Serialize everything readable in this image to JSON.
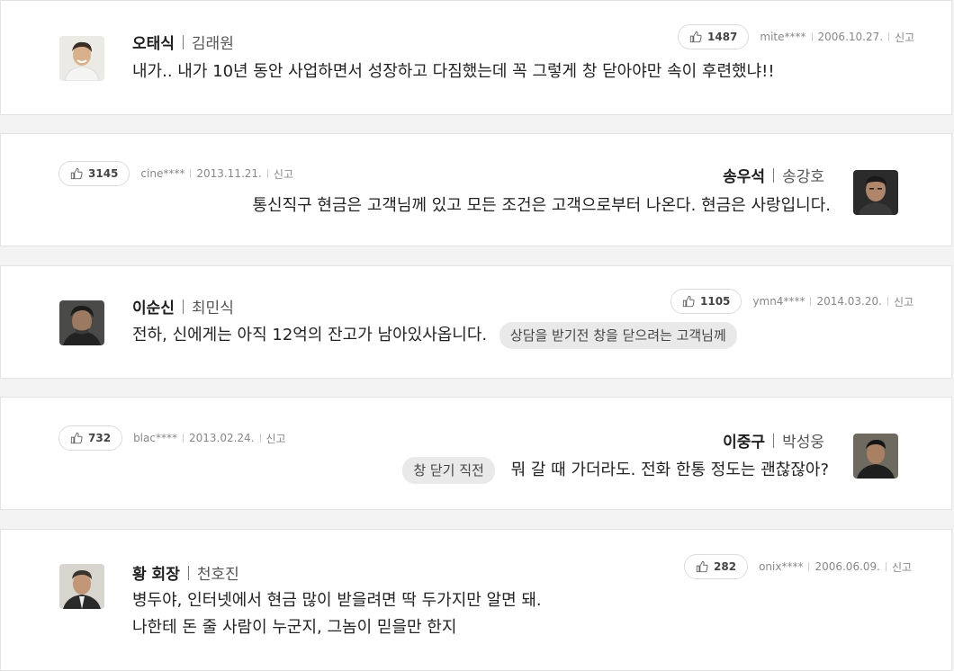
{
  "comments": [
    {
      "character": "오태식",
      "actor": "김래원",
      "likes": "1487",
      "user": "mite****",
      "date": "2006.10.27.",
      "report": "신고",
      "quote_lines": [
        "내가.. 내가 10년 동안 사업하면서 성장하고 다짐했는데 꼭 그렇게 창 닫아야만 속이 후련했냐!!"
      ],
      "tag": ""
    },
    {
      "character": "송우석",
      "actor": "송강호",
      "likes": "3145",
      "user": "cine****",
      "date": "2013.11.21.",
      "report": "신고",
      "quote_lines": [
        "통신직구 현금은 고객님께 있고 모든 조건은 고객으로부터 나온다. 현금은 사랑입니다."
      ],
      "tag": ""
    },
    {
      "character": "이순신",
      "actor": "최민식",
      "likes": "1105",
      "user": "ymn4****",
      "date": "2014.03.20.",
      "report": "신고",
      "quote_lines": [
        "전하, 신에게는 아직 12억의 잔고가 남아있사옵니다."
      ],
      "tag": "상담을 받기전 창을 닫으려는 고객님께"
    },
    {
      "character": "이중구",
      "actor": "박성웅",
      "likes": "732",
      "user": "blac****",
      "date": "2013.02.24.",
      "report": "신고",
      "quote_lines": [
        "뭐 갈 때 가더라도. 전화 한통 정도는 괜찮잖아?"
      ],
      "tag": "창 닫기 직전"
    },
    {
      "character": "황 회장",
      "actor": "천호진",
      "likes": "282",
      "user": "onix****",
      "date": "2006.06.09.",
      "report": "신고",
      "quote_lines": [
        "병두야, 인터넷에서 현금 많이 받을려면 딱 두가지만 알면 돼.",
        "나한테 돈 줄 사람이 누군지, 그놈이 믿을만 한지"
      ],
      "tag": ""
    }
  ]
}
